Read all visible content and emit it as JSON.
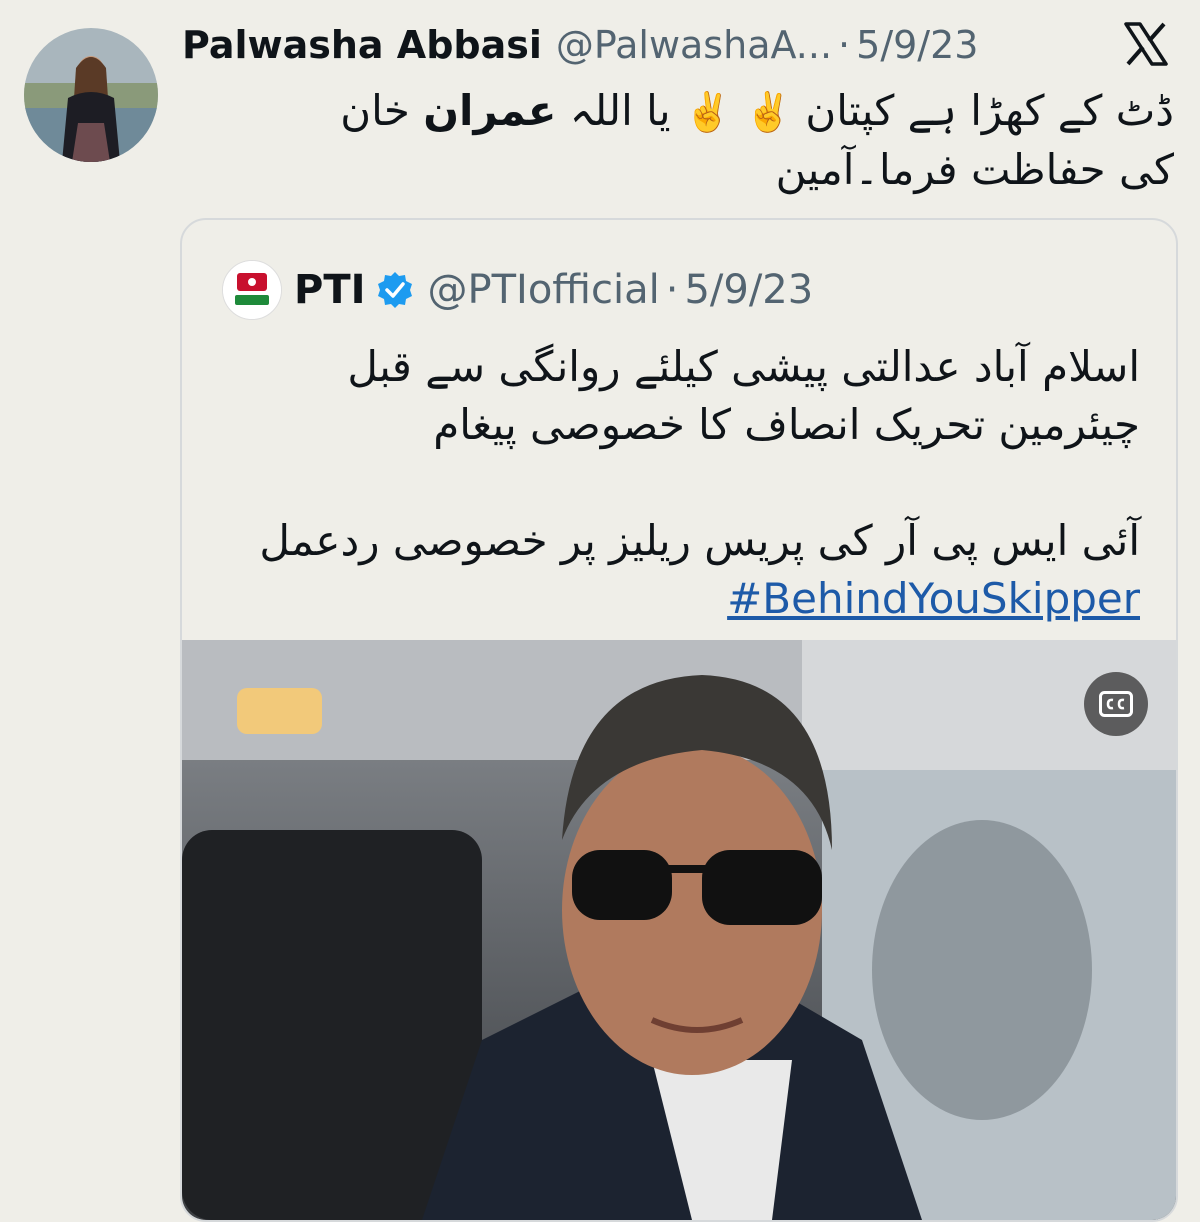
{
  "tweet": {
    "author_name": "Palwasha Abbasi",
    "author_handle": "@PalwashaA...",
    "separator": "·",
    "date": "5/9/23",
    "text_line1_a": "ڈٹ کے کھڑا ہے کپتان",
    "emoji": "✌️",
    "text_line1_b": "یا اللہ",
    "text_bold": "عمران",
    "text_line1_c": "خان کی",
    "text_line2": "حفاظت فرما۔آمین"
  },
  "quoted_tweet": {
    "author_name": "PTI",
    "author_handle": "@PTIofficial",
    "separator": "·",
    "date": "5/9/23",
    "line1": "اسلام آباد عدالتی پیشی کیلئے روانگی سے قبل",
    "line2": "چیئرمین تحریک انصاف کا خصوصی پیغام",
    "line3": "آئی ایس پی آر کی پریس ریلیز پر خصوصی ردعمل",
    "hashtag": "#BehindYouSkipper"
  },
  "icons": {
    "x_logo": "x-logo-icon",
    "verified": "verified-badge-icon",
    "captions": "closed-captions-icon"
  },
  "colors": {
    "background": "#efeee8",
    "highlight": "#fbe646",
    "link": "#1d5aa8",
    "verified": "#1d9bf0",
    "muted": "#536471"
  }
}
